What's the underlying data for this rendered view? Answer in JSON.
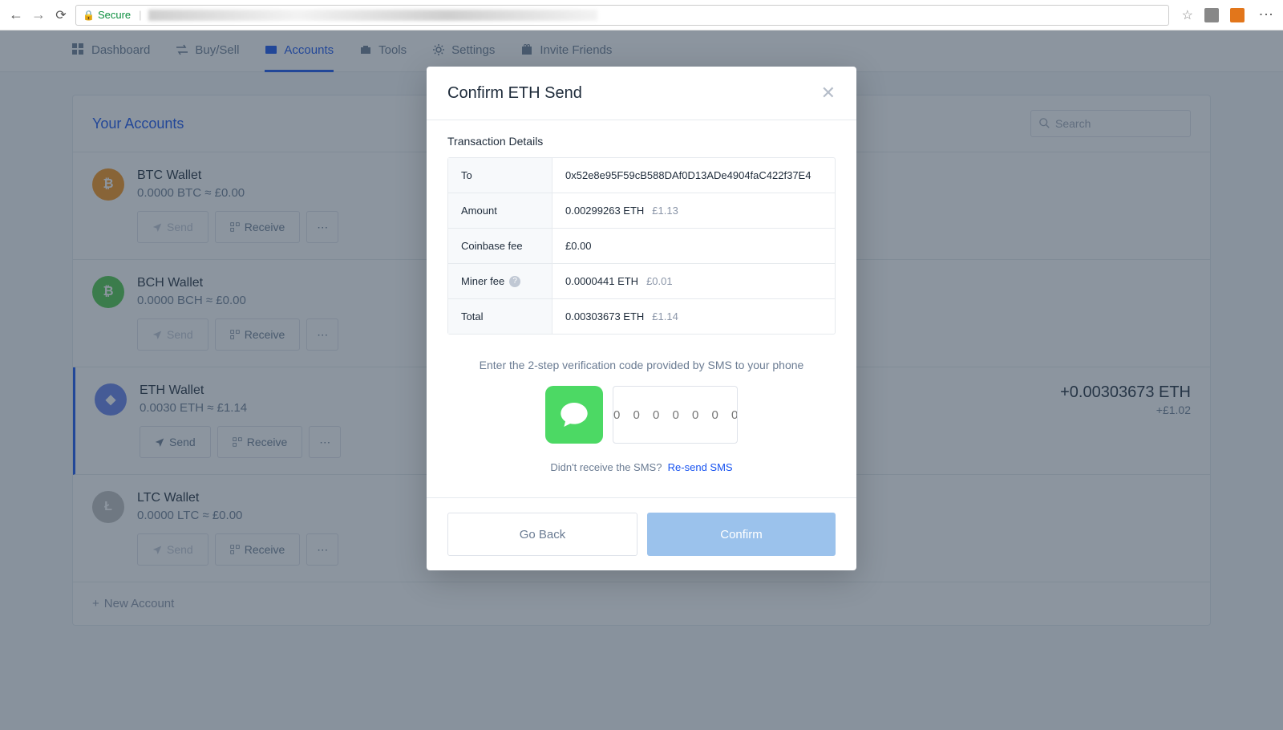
{
  "browser": {
    "secure_label": "Secure"
  },
  "nav": {
    "dashboard": "Dashboard",
    "buysell": "Buy/Sell",
    "accounts": "Accounts",
    "tools": "Tools",
    "settings": "Settings",
    "invite": "Invite Friends"
  },
  "sidebar": {
    "title": "Your Accounts",
    "search_placeholder": "Search",
    "new_account": "New Account",
    "send": "Send",
    "receive": "Receive"
  },
  "wallets": [
    {
      "name": "BTC Wallet",
      "balance": "0.0000 BTC ≈ £0.00",
      "symbol": "BTC"
    },
    {
      "name": "BCH Wallet",
      "balance": "0.0000 BCH ≈ £0.00",
      "symbol": "BCH"
    },
    {
      "name": "ETH Wallet",
      "balance": "0.0030 ETH ≈ £1.14",
      "symbol": "ETH",
      "delta": "+0.00303673 ETH",
      "delta_fiat": "+£1.02"
    },
    {
      "name": "LTC Wallet",
      "balance": "0.0000 LTC ≈ £0.00",
      "symbol": "LTC"
    }
  ],
  "modal": {
    "title": "Confirm ETH Send",
    "section_label": "Transaction Details",
    "rows": {
      "to_label": "To",
      "to_value": "0x52e8e95F59cB588DAf0D13ADe4904faC422f37E4",
      "amount_label": "Amount",
      "amount_value": "0.00299263 ETH",
      "amount_fiat": "£1.13",
      "cbfee_label": "Coinbase fee",
      "cbfee_value": "£0.00",
      "miner_label": "Miner fee",
      "miner_value": "0.0000441 ETH",
      "miner_fiat": "£0.01",
      "total_label": "Total",
      "total_value": "0.00303673 ETH",
      "total_fiat": "£1.14"
    },
    "twofa_label": "Enter the 2-step verification code provided by SMS to your phone",
    "code_placeholder": "0 0 0 0 0 0 0",
    "resend_prompt": "Didn't receive the SMS?",
    "resend_link": "Re-send SMS",
    "go_back": "Go Back",
    "confirm": "Confirm"
  }
}
